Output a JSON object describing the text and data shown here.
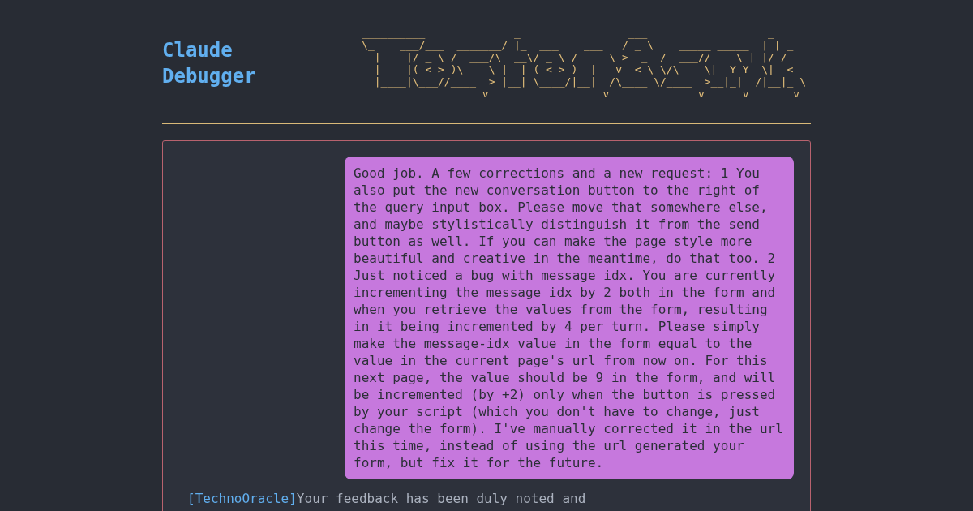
{
  "header": {
    "title": "Claude Debugger",
    "ascii_art_lines": [
      "__________              _                 ___                   _",
      "\\_    ___/___  _______/ |_  ___    ___   / _ \\    _____ _____  | | _",
      "  |    |/ _ \\ /  ___/\\  __\\/ _ \\ /     \\ >  _  /  ___//    \\ | |/ /",
      "  |    |( <_> )\\___ \\ |  | ( <_> )  |   v  <_\\ \\/\\___ \\|  Y Y  \\|  <",
      "  |____|\\___//____  > |__| \\____/|__|  /\\____ \\/____  >__|_|  /|__|_ \\",
      "                   v                  v              v      v       v"
    ]
  },
  "conversation": {
    "messages": [
      {
        "kind": "user",
        "text": "Good job. A few corrections and a new request: 1 You also put the new conversation button to the right of the query input box. Please move that somewhere else, and maybe stylistically distinguish it from the send button as well. If you can make the page style more beautiful and creative in the meantime, do that too. 2 Just noticed a bug with message idx. You are currently incrementing the message idx by 2 both in the form and when you retrieve the values from the form, resulting in it being incremented by 4 per turn. Please simply make the message-idx value in the form equal to the value in the current page's url from now on. For this next page, the value should be 9 in the form, and will be incremented (by +2) only when the button is pressed by your script (which you don't have to change, just change the form). I've manually corrected it in the url this time, instead of using the url generated your form, but fix it for the future."
      },
      {
        "kind": "assistant",
        "speaker": "[TechnoOracle]",
        "text": "Your feedback has been duly noted and"
      }
    ]
  }
}
